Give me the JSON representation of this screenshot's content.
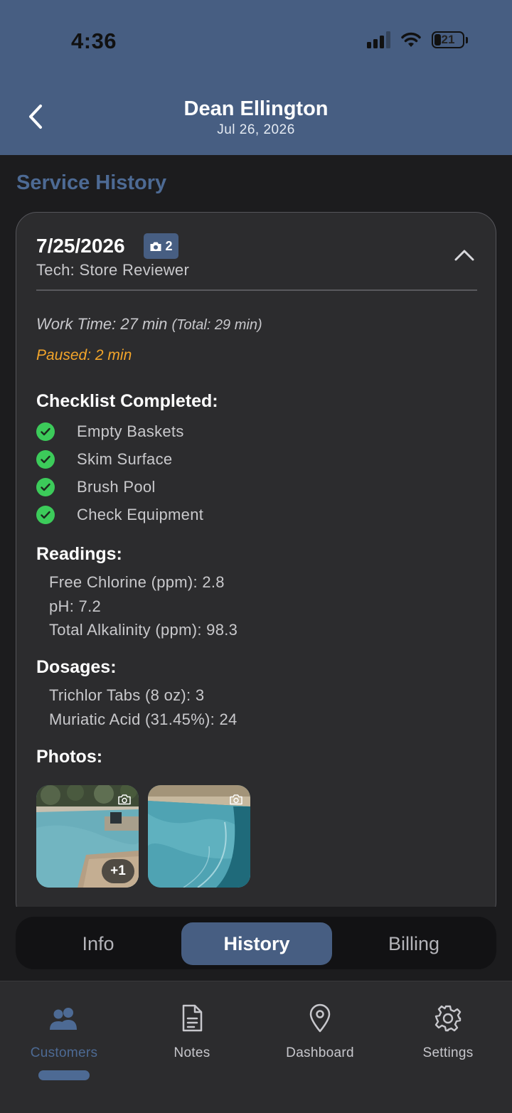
{
  "status_bar": {
    "time": "4:36",
    "battery": "21"
  },
  "header": {
    "title": "Dean Ellington",
    "date": "Jul 26, 2026"
  },
  "section_title": "Service History",
  "visit": {
    "date": "7/25/2026",
    "photo_count": "2",
    "tech": "Tech: Store Reviewer",
    "work_time": "Work Time: 27 min",
    "total_time": "(Total: 29 min)",
    "paused": "Paused: 2 min",
    "checklist_label": "Checklist Completed:",
    "checklist": [
      "Empty Baskets",
      "Skim Surface",
      "Brush Pool",
      "Check Equipment"
    ],
    "readings_label": "Readings:",
    "readings": [
      "Free Chlorine (ppm): 2.8",
      "pH: 7.2",
      "Total Alkalinity (ppm): 98.3"
    ],
    "dosages_label": "Dosages:",
    "dosages": [
      "Trichlor Tabs (8 oz): 3",
      "Muriatic Acid (31.45%): 24"
    ],
    "photos_label": "Photos:",
    "photo_more": "+1"
  },
  "tabs": [
    "Info",
    "History",
    "Billing"
  ],
  "active_tab": "History",
  "nav": [
    "Customers",
    "Notes",
    "Dashboard",
    "Settings"
  ],
  "active_nav": "Customers",
  "colors": {
    "accent": "#475e82",
    "check": "#3ccb5a",
    "paused": "#f3a52a"
  }
}
